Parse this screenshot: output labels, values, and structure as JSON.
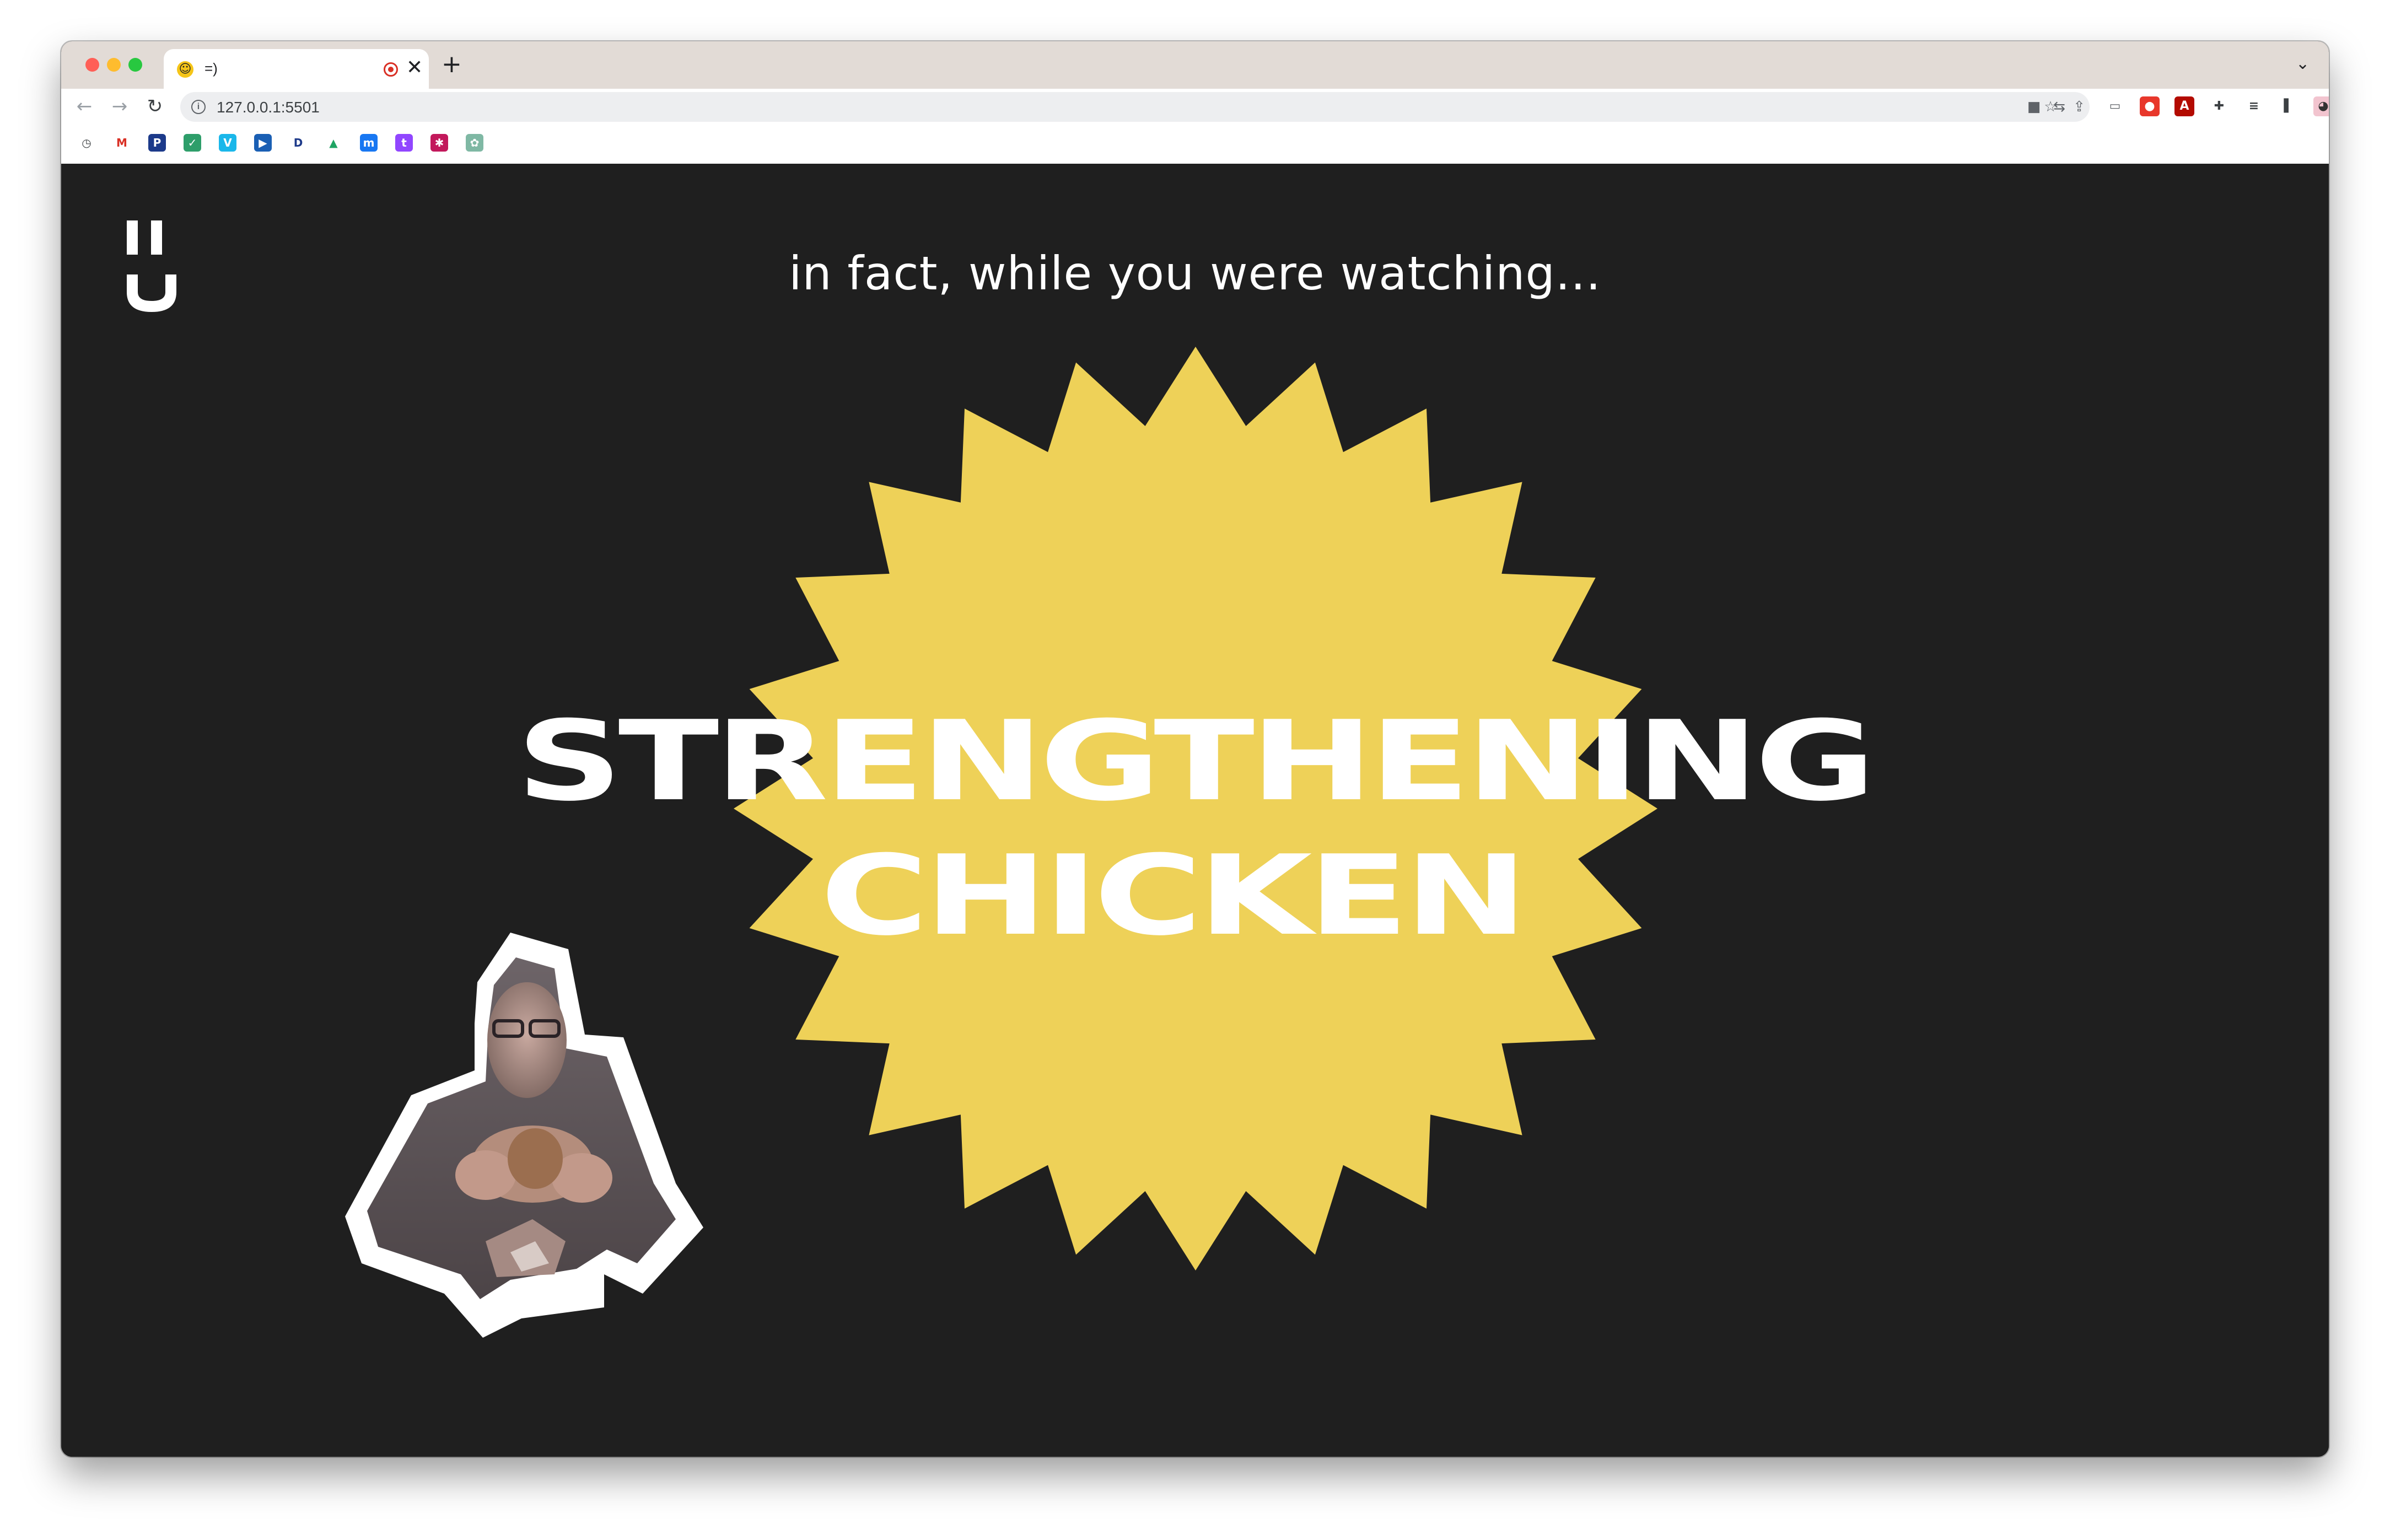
{
  "browser": {
    "tab": {
      "favicon_glyph": "☺",
      "title": "=)"
    },
    "new_tab_symbol": "+",
    "close_symbol": "✕",
    "tab_search_symbol": "⌄",
    "nav": {
      "back": "←",
      "forward": "→",
      "reload": "↻"
    },
    "address": {
      "url": "127.0.0.1:5501",
      "info_glyph": "i"
    },
    "omnibox_icons": [
      "camera-icon",
      "translate-icon",
      "share-icon",
      "bookmark-star-icon"
    ],
    "omnibox_glyphs": [
      "■",
      "⇆",
      "⇪",
      "☆"
    ],
    "extensions": [
      {
        "name": "screen-cast-icon",
        "glyph": "▭",
        "color": "#ffffff",
        "fg": "#5f6368"
      },
      {
        "name": "record-extension-icon",
        "glyph": "●",
        "color": "#e8372b",
        "fg": "#ffffff"
      },
      {
        "name": "acrobat-icon",
        "glyph": "A",
        "color": "#b30b00",
        "fg": "#ffffff"
      },
      {
        "name": "puzzle-extensions-icon",
        "glyph": "✚",
        "color": "#ffffff",
        "fg": "#3c4043"
      },
      {
        "name": "reading-list-icon",
        "glyph": "≡",
        "color": "#ffffff",
        "fg": "#3c4043"
      },
      {
        "name": "side-panel-icon",
        "glyph": "▌",
        "color": "#ffffff",
        "fg": "#3c4043"
      },
      {
        "name": "profile-avatar-icon",
        "glyph": "◕",
        "color": "#f2c4cf",
        "fg": "#333333"
      },
      {
        "name": "more-menu-icon",
        "glyph": "⋮",
        "color": "#ffffff",
        "fg": "#3c4043"
      }
    ],
    "bookmarks": [
      {
        "name": "history-bookmark-icon",
        "glyph": "◷",
        "color": "#ffffff",
        "fg": "#3c4043"
      },
      {
        "name": "gmail-bookmark-icon",
        "glyph": "M",
        "color": "#ffffff",
        "fg": "#d93025"
      },
      {
        "name": "pluralsight-bookmark-icon",
        "glyph": "P",
        "color": "#1c3a8a",
        "fg": "#ffffff"
      },
      {
        "name": "todo-bookmark-icon",
        "glyph": "✓",
        "color": "#2e9e6a",
        "fg": "#ffffff"
      },
      {
        "name": "vimeo-bookmark-icon",
        "glyph": "V",
        "color": "#1ab7ea",
        "fg": "#ffffff"
      },
      {
        "name": "play-bookmark-icon",
        "glyph": "▶",
        "color": "#1a5fb4",
        "fg": "#ffffff"
      },
      {
        "name": "disney-bookmark-icon",
        "glyph": "D",
        "color": "#ffffff",
        "fg": "#1e3a8a"
      },
      {
        "name": "drive-bookmark-icon",
        "glyph": "▲",
        "color": "#ffffff",
        "fg": "#1fa463"
      },
      {
        "name": "messenger-bookmark-icon",
        "glyph": "m",
        "color": "#1877f2",
        "fg": "#ffffff"
      },
      {
        "name": "twitch-bookmark-icon",
        "glyph": "t",
        "color": "#9146ff",
        "fg": "#ffffff"
      },
      {
        "name": "app-bookmark-icon",
        "glyph": "✱",
        "color": "#c2185b",
        "fg": "#ffffff"
      },
      {
        "name": "chatgpt-bookmark-icon",
        "glyph": "✿",
        "color": "#7fb8a4",
        "fg": "#ffffff"
      }
    ]
  },
  "page": {
    "background": "#1f1f1f",
    "subtitle": "in fact, while you were watching...",
    "headline": [
      "STRENGTHENING",
      "CHICKEN"
    ],
    "starburst_color": "#eed158",
    "logo_name": "site-logo"
  }
}
